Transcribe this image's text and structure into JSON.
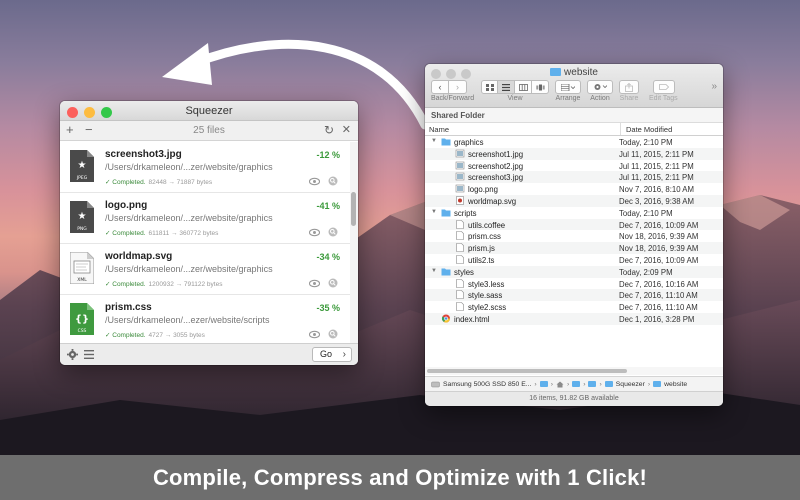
{
  "banner": {
    "text": "Compile, Compress and Optimize with 1 Click!"
  },
  "squeezer": {
    "title": "Squeezer",
    "toolbar": {
      "add": "+",
      "remove": "−",
      "count": "25 files",
      "refresh": "↻",
      "close": "✕"
    },
    "items": [
      {
        "name": "screenshot3.jpg",
        "path": "/Users/drkameleon/...zer/website/graphics",
        "percent": "-12 %",
        "status": "✓ Completed.",
        "sizes": "82448 → 71887 bytes",
        "badge": "JPEG",
        "glyph": "★"
      },
      {
        "name": "logo.png",
        "path": "/Users/drkameleon/...zer/website/graphics",
        "percent": "-41 %",
        "status": "✓ Completed.",
        "sizes": "611811 → 360772 bytes",
        "badge": "PNG",
        "glyph": "★"
      },
      {
        "name": "worldmap.svg",
        "path": "/Users/drkameleon/...zer/website/graphics",
        "percent": "-34 %",
        "status": "✓ Completed.",
        "sizes": "1200932 → 791122 bytes",
        "badge": "XML",
        "glyph": ""
      },
      {
        "name": "prism.css",
        "path": "/Users/drkameleon/...ezer/website/scripts",
        "percent": "-35 %",
        "status": "✓ Completed.",
        "sizes": "4727 → 3055 bytes",
        "badge": "CSS",
        "glyph": "{}"
      }
    ],
    "footer": {
      "go": "Go",
      "go_chevron": "›"
    }
  },
  "finder": {
    "title": "website",
    "toolbar": {
      "back_forward": "Back/Forward",
      "view": "View",
      "arrange": "Arrange",
      "action": "Action",
      "share": "Share",
      "edit_tags": "Edit Tags",
      "back": "‹",
      "forward": "›",
      "more": "»"
    },
    "section": "Shared Folder",
    "columns": {
      "name": "Name",
      "date": "Date Modified"
    },
    "rows": [
      {
        "level": 0,
        "kind": "folder",
        "name": "graphics",
        "date": "Today, 2:10 PM",
        "expanded": true
      },
      {
        "level": 1,
        "kind": "image",
        "name": "screenshot1.jpg",
        "date": "Jul 11, 2015, 2:11 PM"
      },
      {
        "level": 1,
        "kind": "image",
        "name": "screenshot2.jpg",
        "date": "Jul 11, 2015, 2:11 PM"
      },
      {
        "level": 1,
        "kind": "image",
        "name": "screenshot3.jpg",
        "date": "Jul 11, 2015, 2:11 PM"
      },
      {
        "level": 1,
        "kind": "image",
        "name": "logo.png",
        "date": "Nov 7, 2016, 8:10 AM"
      },
      {
        "level": 1,
        "kind": "svg",
        "name": "worldmap.svg",
        "date": "Dec 3, 2016, 9:38 AM"
      },
      {
        "level": 0,
        "kind": "folder",
        "name": "scripts",
        "date": "Today, 2:10 PM",
        "expanded": true
      },
      {
        "level": 1,
        "kind": "doc",
        "name": "utils.coffee",
        "date": "Dec 7, 2016, 10:09 AM"
      },
      {
        "level": 1,
        "kind": "doc",
        "name": "prism.css",
        "date": "Nov 18, 2016, 9:39 AM"
      },
      {
        "level": 1,
        "kind": "doc",
        "name": "prism.js",
        "date": "Nov 18, 2016, 9:39 AM"
      },
      {
        "level": 1,
        "kind": "doc",
        "name": "utils2.ts",
        "date": "Dec 7, 2016, 10:09 AM"
      },
      {
        "level": 0,
        "kind": "folder",
        "name": "styles",
        "date": "Today, 2:09 PM",
        "expanded": true
      },
      {
        "level": 1,
        "kind": "doc",
        "name": "style3.less",
        "date": "Dec 7, 2016, 10:16 AM"
      },
      {
        "level": 1,
        "kind": "doc",
        "name": "style.sass",
        "date": "Dec 7, 2016, 11:10 AM"
      },
      {
        "level": 1,
        "kind": "doc",
        "name": "style2.scss",
        "date": "Dec 7, 2016, 11:10 AM"
      },
      {
        "level": 0,
        "kind": "chrome",
        "name": "index.html",
        "date": "Dec 1, 2016, 3:28 PM"
      }
    ],
    "path": [
      "Samsung 500G SSD 850 E...",
      "",
      "",
      "",
      "Squeezer",
      "website"
    ],
    "status": "16 items, 91.82 GB available"
  },
  "colors": {
    "green_percent": "#3b9a3b",
    "folder_blue": "#5fb0ec",
    "close_red": "#fc605c",
    "minimize_yellow": "#fdbc40",
    "zoom_green": "#34c84a",
    "banner_gray": "#6e6e6e"
  }
}
